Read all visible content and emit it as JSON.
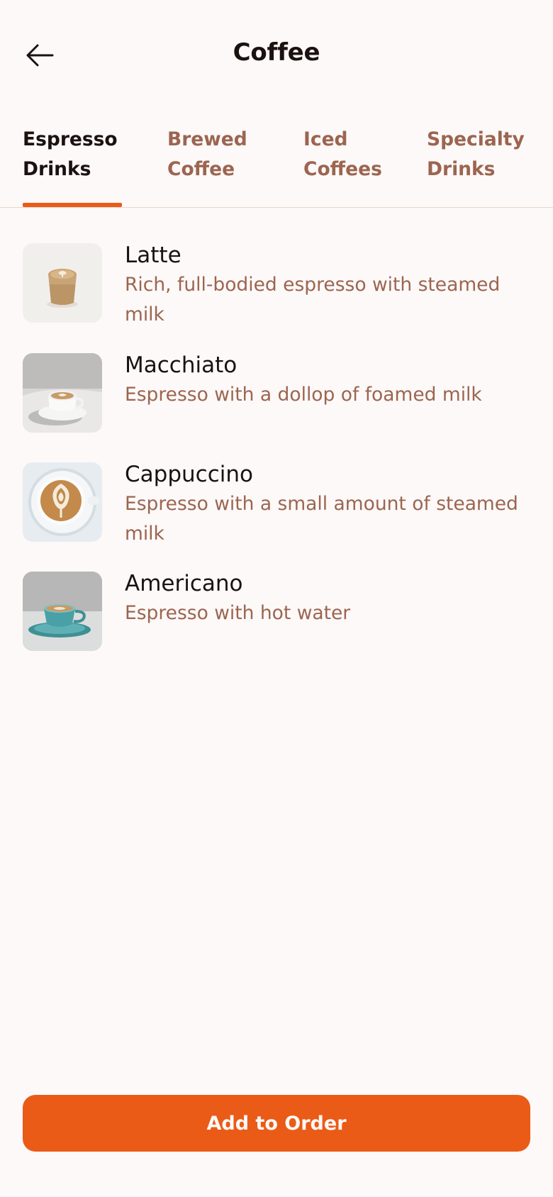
{
  "header": {
    "title": "Coffee",
    "back_icon": "arrow-left-icon"
  },
  "tabs": [
    {
      "label_line1": "Espresso",
      "label_line2": "Drinks",
      "active": true
    },
    {
      "label_line1": "Brewed",
      "label_line2": "Coffee",
      "active": false
    },
    {
      "label_line1": "Iced",
      "label_line2": "Coffees",
      "active": false
    },
    {
      "label_line1": "Specialty",
      "label_line2": "Drinks",
      "active": false
    }
  ],
  "items": [
    {
      "name": "Latte",
      "description": "Rich, full-bodied espresso with steamed milk",
      "image": "latte-image"
    },
    {
      "name": "Macchiato",
      "description": "Espresso with a dollop of foamed milk",
      "image": "macchiato-image"
    },
    {
      "name": "Cappuccino",
      "description": "Espresso with a small amount of steamed milk",
      "image": "cappuccino-image"
    },
    {
      "name": "Americano",
      "description": "Espresso with hot water",
      "image": "americano-image"
    }
  ],
  "footer": {
    "add_button_label": "Add to Order"
  },
  "colors": {
    "accent": "#ea5b17",
    "text_primary": "#1b1210",
    "text_secondary": "#9c6550",
    "background": "#fcf9f8",
    "divider": "#e8d6d0"
  }
}
